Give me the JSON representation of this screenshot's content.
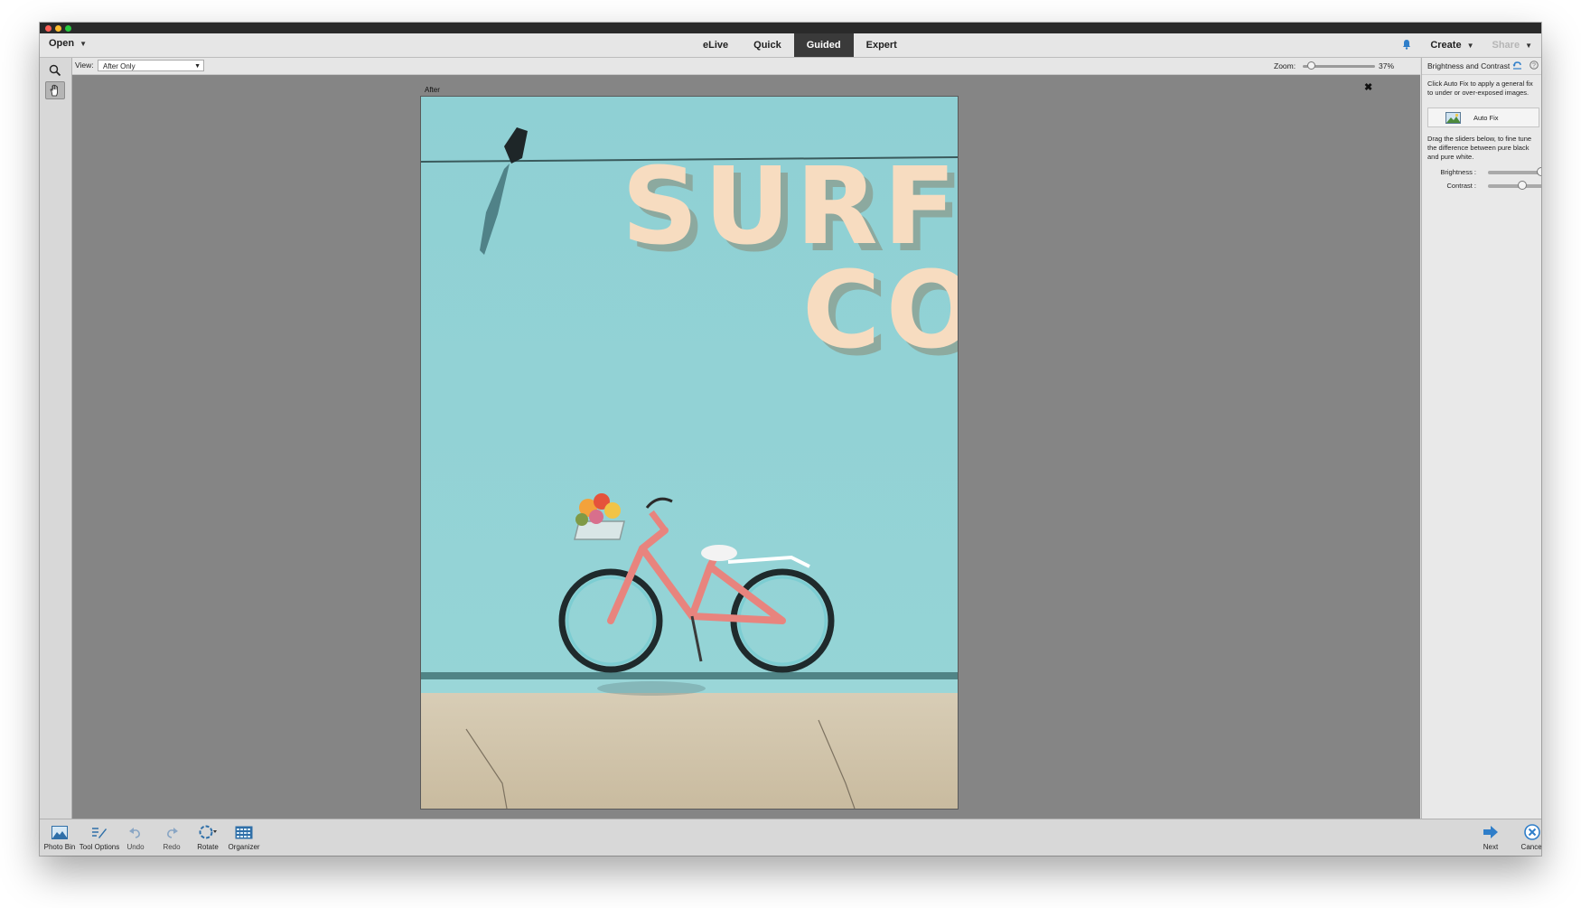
{
  "topbar": {
    "open_label": "Open",
    "modes": [
      "eLive",
      "Quick",
      "Guided",
      "Expert"
    ],
    "active_mode": "Guided",
    "create_label": "Create",
    "share_label": "Share"
  },
  "options": {
    "view_label": "View:",
    "view_value": "After Only",
    "zoom_label": "Zoom:",
    "zoom_value": "37%",
    "zoom_level": 0.12
  },
  "canvas": {
    "after_label": "After",
    "close_symbol": "✖"
  },
  "photo": {
    "sign_line1": "SURF",
    "sign_line2": "CO"
  },
  "panel": {
    "title": "Brightness and Contrast",
    "intro": "Click Auto Fix to apply a general fix to under or over-exposed images.",
    "autofix_label": "Auto Fix",
    "instructions": "Drag the sliders below, to fine tune the difference between pure black and pure white.",
    "brightness_label": "Brightness :",
    "brightness_level": 0.65,
    "contrast_label": "Contrast :",
    "contrast_level": 0.42
  },
  "bottombar": {
    "photo_bin": "Photo Bin",
    "tool_options": "Tool Options",
    "undo": "Undo",
    "redo": "Redo",
    "rotate": "Rotate",
    "organizer": "Organizer",
    "next": "Next",
    "cancel": "Cancel"
  },
  "colors": {
    "accent": "#2f7ec9",
    "active_tab": "#3a3a3a",
    "canvas_bg": "#858585",
    "wall": "#8ccdd1",
    "bike": "#e8847e"
  },
  "icons": {
    "zoom_tool": "zoom-icon",
    "hand_tool": "hand-icon",
    "notification": "bell-icon",
    "reset": "reset-icon",
    "help": "help-icon"
  }
}
